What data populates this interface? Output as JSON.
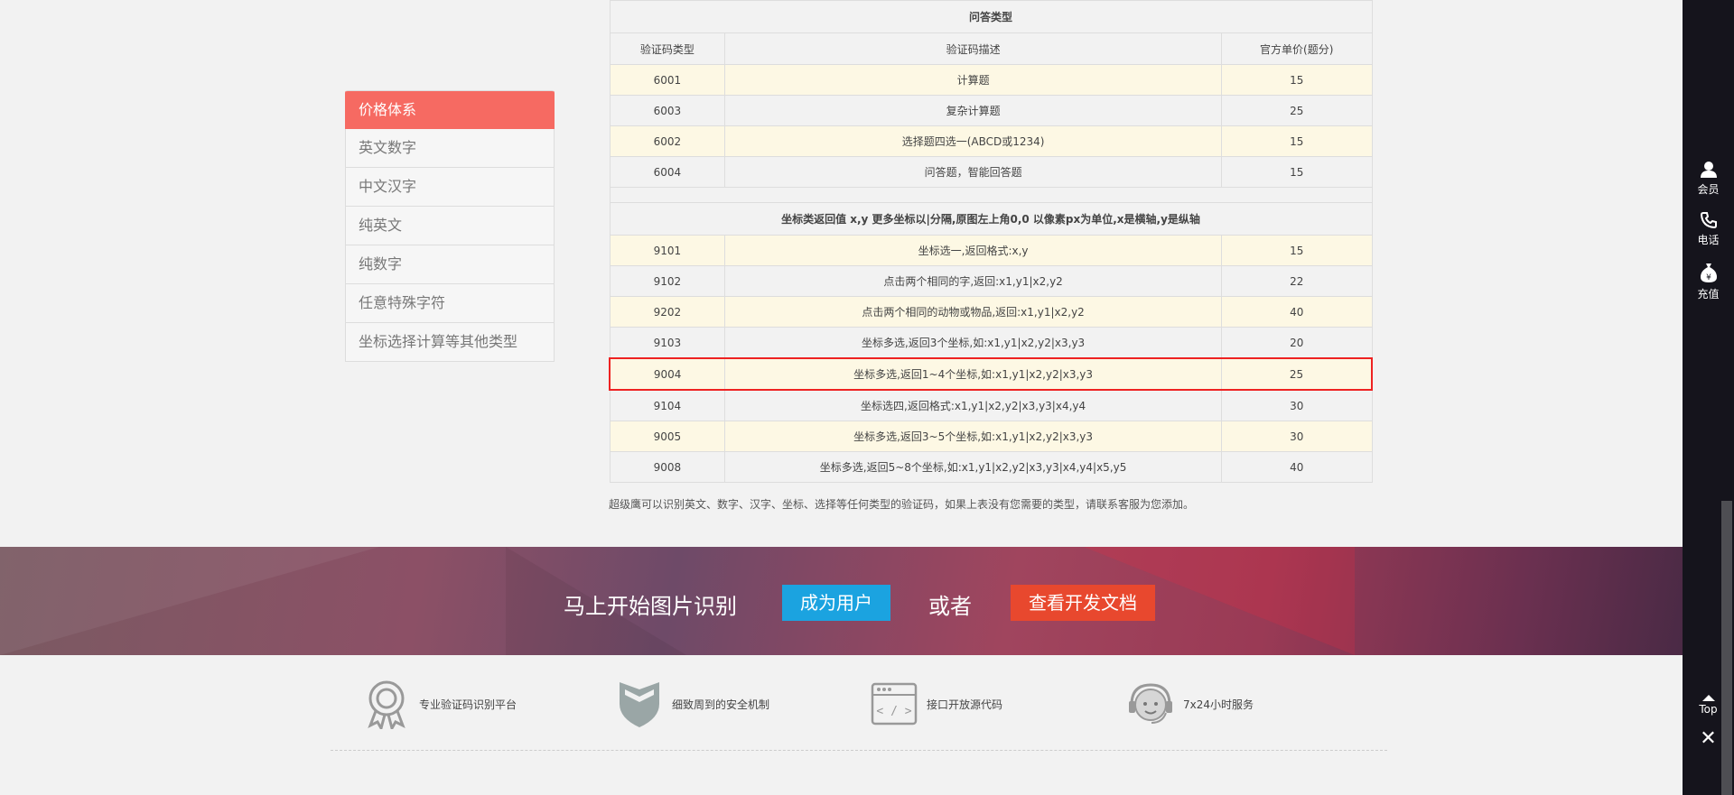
{
  "sidebar": {
    "items": [
      {
        "label": "价格体系"
      },
      {
        "label": "英文数字"
      },
      {
        "label": "中文汉字"
      },
      {
        "label": "纯英文"
      },
      {
        "label": "纯数字"
      },
      {
        "label": "任意特殊字符"
      },
      {
        "label": "坐标选择计算等其他类型"
      }
    ]
  },
  "table": {
    "section1_title": "问答类型",
    "headers": [
      "验证码类型",
      "验证码描述",
      "官方单价(题分)"
    ],
    "section1_rows": [
      [
        "6001",
        "计算题",
        "15"
      ],
      [
        "6003",
        "复杂计算题",
        "25"
      ],
      [
        "6002",
        "选择题四选一(ABCD或1234)",
        "15"
      ],
      [
        "6004",
        "问答题，智能回答题",
        "15"
      ]
    ],
    "section2_title": "坐标类返回值 x,y 更多坐标以|分隔,原图左上角0,0 以像素px为单位,x是横轴,y是纵轴",
    "section2_rows": [
      [
        "9101",
        "坐标选一,返回格式:x,y",
        "15"
      ],
      [
        "9102",
        "点击两个相同的字,返回:x1,y1|x2,y2",
        "22"
      ],
      [
        "9202",
        "点击两个相同的动物或物品,返回:x1,y1|x2,y2",
        "40"
      ],
      [
        "9103",
        "坐标多选,返回3个坐标,如:x1,y1|x2,y2|x3,y3",
        "20"
      ],
      [
        "9004",
        "坐标多选,返回1~4个坐标,如:x1,y1|x2,y2|x3,y3",
        "25"
      ],
      [
        "9104",
        "坐标选四,返回格式:x1,y1|x2,y2|x3,y3|x4,y4",
        "30"
      ],
      [
        "9005",
        "坐标多选,返回3~5个坐标,如:x1,y1|x2,y2|x3,y3",
        "30"
      ],
      [
        "9008",
        "坐标多选,返回5~8个坐标,如:x1,y1|x2,y2|x3,y3|x4,y4|x5,y5",
        "40"
      ]
    ]
  },
  "note": "超级鹰可以识别英文、数字、汉字、坐标、选择等任何类型的验证码，如果上表没有您需要的类型，请联系客服为您添加。",
  "banner": {
    "title": "马上开始图片识别",
    "register_label": "成为用户",
    "or_label": "或者",
    "docs_label": "查看开发文档",
    "register_color": "#1ba3e0",
    "docs_color": "#e8482e"
  },
  "features": [
    {
      "label": "专业验证码识别平台",
      "icon": "award-icon"
    },
    {
      "label": "细致周到的安全机制",
      "icon": "shield-icon"
    },
    {
      "label": "接口开放源代码",
      "icon": "code-window-icon"
    },
    {
      "label": "7x24小时服务",
      "icon": "support-headset-icon"
    }
  ],
  "rail": {
    "member_label": "会员",
    "phone_label": "电话",
    "recharge_label": "充值",
    "top_label": "Top"
  }
}
